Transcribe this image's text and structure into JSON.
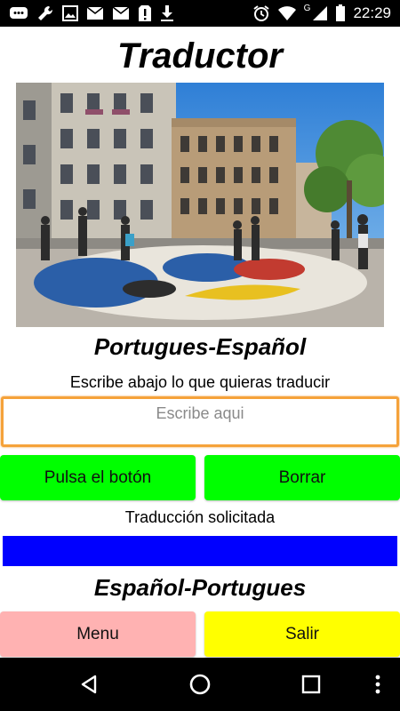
{
  "status_bar": {
    "time": "22:29",
    "network_letter": "G",
    "icons_left": [
      "chat-icon",
      "wrench-icon",
      "image-icon",
      "mail-icon",
      "mail-icon",
      "alert-icon",
      "download-icon"
    ],
    "icons_right": [
      "alarm-icon",
      "wifi-icon",
      "signal-icon",
      "battery-icon"
    ]
  },
  "app": {
    "title": "Traductor",
    "section_pt_es": "Portugues-Español",
    "instruction": "Escribe abajo lo que quieras traducir",
    "input": {
      "placeholder": "Escribe aqui",
      "value": ""
    },
    "translate_button": "Pulsa el botón",
    "clear_button": "Borrar",
    "result_label": "Traducción solicitada",
    "result_value": "",
    "section_es_pt": "Español-Portugues",
    "menu_button": "Menu",
    "exit_button": "Salir"
  },
  "colors": {
    "green_button": "#00ff00",
    "result_box": "#0000ff",
    "menu_button": "#ffb2b2",
    "exit_button": "#ffff00",
    "input_focus_border": "#f5a23a"
  },
  "nav_bar": {
    "icons": [
      "back-icon",
      "home-icon",
      "recents-icon",
      "more-icon"
    ]
  }
}
